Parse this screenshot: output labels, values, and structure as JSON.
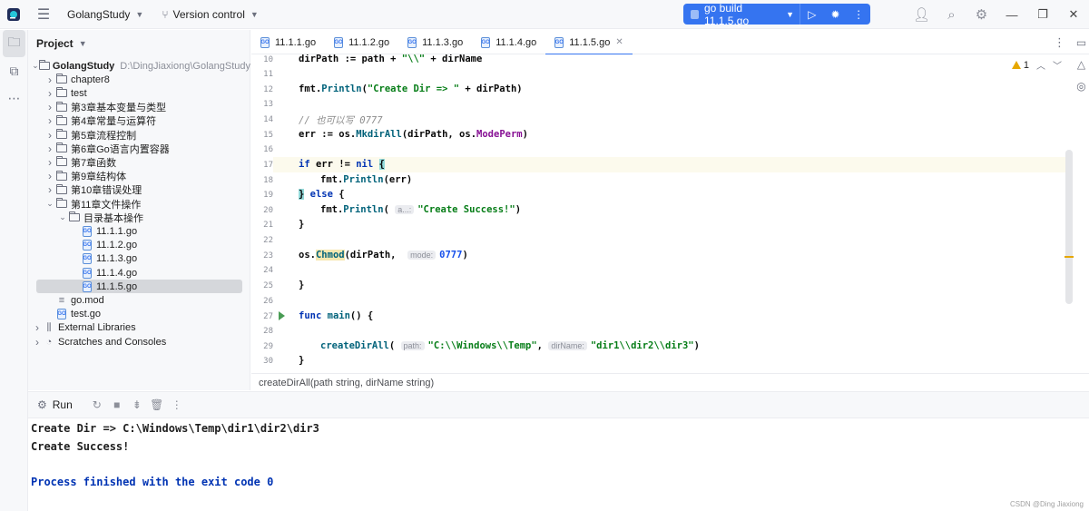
{
  "titlebar": {
    "project_name": "GolangStudy",
    "vcs_label": "Version control",
    "run_config": "go build 11.1.5.go"
  },
  "project_panel": {
    "title": "Project",
    "tree": [
      {
        "label": "GolangStudy",
        "path": "D:\\DingJiaxiong\\GolangStudy",
        "type": "folder",
        "depth": 0,
        "expanded": true
      },
      {
        "label": "chapter8",
        "type": "folder",
        "depth": 1
      },
      {
        "label": "test",
        "type": "folder",
        "depth": 1
      },
      {
        "label": "第3章基本变量与类型",
        "type": "folder",
        "depth": 1
      },
      {
        "label": "第4章常量与运算符",
        "type": "folder",
        "depth": 1
      },
      {
        "label": "第5章流程控制",
        "type": "folder",
        "depth": 1
      },
      {
        "label": "第6章Go语言内置容器",
        "type": "folder",
        "depth": 1
      },
      {
        "label": "第7章函数",
        "type": "folder",
        "depth": 1
      },
      {
        "label": "第9章结构体",
        "type": "folder",
        "depth": 1
      },
      {
        "label": "第10章错误处理",
        "type": "folder",
        "depth": 1
      },
      {
        "label": "第11章文件操作",
        "type": "folder",
        "depth": 1,
        "expanded": true
      },
      {
        "label": "目录基本操作",
        "type": "folder",
        "depth": 2,
        "expanded": true
      },
      {
        "label": "11.1.1.go",
        "type": "gofile",
        "depth": 3
      },
      {
        "label": "11.1.2.go",
        "type": "gofile",
        "depth": 3
      },
      {
        "label": "11.1.3.go",
        "type": "gofile",
        "depth": 3
      },
      {
        "label": "11.1.4.go",
        "type": "gofile",
        "depth": 3
      },
      {
        "label": "11.1.5.go",
        "type": "gofile",
        "depth": 3,
        "selected": true
      },
      {
        "label": "go.mod",
        "type": "mod",
        "depth": 1
      },
      {
        "label": "test.go",
        "type": "gofile",
        "depth": 1
      },
      {
        "label": "External Libraries",
        "type": "lib",
        "depth": 0
      },
      {
        "label": "Scratches and Consoles",
        "type": "scratch",
        "depth": 0
      }
    ]
  },
  "tabs": [
    {
      "label": "11.1.1.go",
      "active": false
    },
    {
      "label": "11.1.2.go",
      "active": false
    },
    {
      "label": "11.1.3.go",
      "active": false
    },
    {
      "label": "11.1.4.go",
      "active": false
    },
    {
      "label": "11.1.5.go",
      "active": true
    }
  ],
  "editor": {
    "warning_count": "1",
    "line_numbers": [
      "10",
      "11",
      "12",
      "13",
      "14",
      "15",
      "16",
      "17",
      "18",
      "19",
      "20",
      "21",
      "22",
      "23",
      "24",
      "25",
      "26",
      "27",
      "28",
      "29",
      "30"
    ],
    "code": {
      "l10": {
        "a": "dirPath := path + ",
        "b": "\"\\\\\"",
        "c": " + dirName"
      },
      "l12": {
        "pkg": "fmt",
        "dot": ".",
        "call": "Println",
        "open": "(",
        "str": "\"Create Dir => \"",
        "rest": " + dirPath)"
      },
      "l14": {
        "cmt": "// 也可以写 0777"
      },
      "l15": {
        "a": "err := ",
        "pkg": "os",
        "dot": ".",
        "call": "MkdirAll",
        "b": "(dirPath, ",
        "pkg2": "os",
        "dot2": ".",
        "const": "ModePerm",
        "c": ")"
      },
      "l17": {
        "kw": "if",
        "a": " err != ",
        "kw2": "nil",
        "sp": " ",
        "brace": "{"
      },
      "l18": {
        "pkg": "fmt",
        "dot": ".",
        "call": "Println",
        "a": "(err)"
      },
      "l19": {
        "brace": "}",
        "sp": " ",
        "kw": "else",
        "a": " {"
      },
      "l20": {
        "pkg": "fmt",
        "dot": ".",
        "call": "Println",
        "open": "(",
        "hint": "a...:",
        "str": "\"Create Success!\"",
        "close": ")"
      },
      "l21": {
        "a": "}"
      },
      "l23": {
        "pkg": "os",
        "dot": ".",
        "call": "Chmod",
        "a": "(dirPath, ",
        "hint": "mode:",
        "num": "0777",
        "close": ")"
      },
      "l25": {
        "a": "}"
      },
      "l27": {
        "kw": "func",
        "sp": " ",
        "fn": "main",
        "a": "() {"
      },
      "l29": {
        "call": "createDirAll",
        "open": "(",
        "hint1": "path:",
        "str1": "\"C:\\\\Windows\\\\Temp\"",
        "comma": ", ",
        "hint2": "dirName:",
        "str2": "\"dir1\\\\dir2\\\\dir3\"",
        "close": ")"
      },
      "l30": {
        "a": "}"
      }
    }
  },
  "breadcrumb": "createDirAll(path string, dirName string)",
  "run_panel": {
    "tab_label": "Run",
    "console_lines": [
      "Create Dir => C:\\Windows\\Temp\\dir1\\dir2\\dir3",
      "Create Success!",
      "",
      "Process finished with the exit code 0"
    ]
  },
  "watermark": "CSDN @Ding Jiaxiong",
  "colors": {
    "accent": "#3574f0",
    "keyword": "#0033b3",
    "string": "#067d17",
    "number": "#1750eb",
    "function": "#00627a"
  }
}
